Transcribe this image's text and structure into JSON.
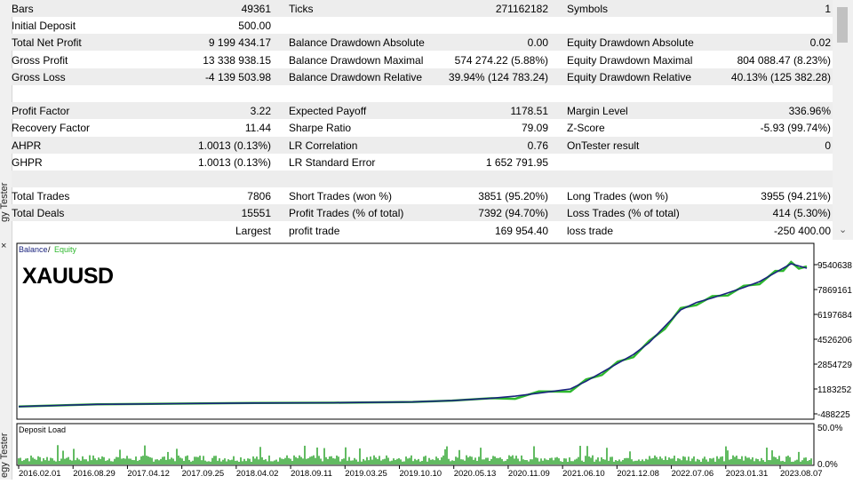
{
  "sidebar": {
    "tab_label_top": "gy Tester",
    "tab_label_bottom": "egy Tester",
    "close_glyph": "×"
  },
  "stats": [
    {
      "gray": true,
      "c1": [
        "Bars",
        "49361"
      ],
      "c2": [
        "Ticks",
        "271162182"
      ],
      "c3": [
        "Symbols",
        "1"
      ]
    },
    {
      "gray": false,
      "c1": [
        "Initial Deposit",
        "500.00"
      ],
      "c2": [
        "",
        ""
      ],
      "c3": [
        "",
        ""
      ]
    },
    {
      "gray": true,
      "c1": [
        "Total Net Profit",
        "9 199 434.17"
      ],
      "c2": [
        "Balance Drawdown Absolute",
        "0.00"
      ],
      "c3": [
        "Equity Drawdown Absolute",
        "0.02"
      ]
    },
    {
      "gray": false,
      "c1": [
        "Gross Profit",
        "13 338 938.15"
      ],
      "c2": [
        "Balance Drawdown Maximal",
        "574 274.22 (5.88%)"
      ],
      "c3": [
        "Equity Drawdown Maximal",
        "804 088.47 (8.23%)"
      ]
    },
    {
      "gray": true,
      "c1": [
        "Gross Loss",
        "-4 139 503.98"
      ],
      "c2": [
        "Balance Drawdown Relative",
        "39.94% (124 783.24)"
      ],
      "c3": [
        "Equity Drawdown Relative",
        "40.13% (125 382.28)"
      ]
    },
    {
      "gray": false,
      "c1": [
        "",
        ""
      ],
      "c2": [
        "",
        ""
      ],
      "c3": [
        "",
        ""
      ]
    },
    {
      "gray": true,
      "c1": [
        "Profit Factor",
        "3.22"
      ],
      "c2": [
        "Expected Payoff",
        "1178.51"
      ],
      "c3": [
        "Margin Level",
        "336.96%"
      ]
    },
    {
      "gray": false,
      "c1": [
        "Recovery Factor",
        "11.44"
      ],
      "c2": [
        "Sharpe Ratio",
        "79.09"
      ],
      "c3": [
        "Z-Score",
        "-5.93 (99.74%)"
      ]
    },
    {
      "gray": true,
      "c1": [
        "AHPR",
        "1.0013 (0.13%)"
      ],
      "c2": [
        "LR Correlation",
        "0.76"
      ],
      "c3": [
        "OnTester result",
        "0"
      ]
    },
    {
      "gray": false,
      "c1": [
        "GHPR",
        "1.0013 (0.13%)"
      ],
      "c2": [
        "LR Standard Error",
        "1 652 791.95"
      ],
      "c3": [
        "",
        ""
      ]
    },
    {
      "gray": true,
      "c1": [
        "",
        ""
      ],
      "c2": [
        "",
        ""
      ],
      "c3": [
        "",
        ""
      ]
    },
    {
      "gray": false,
      "c1": [
        "Total Trades",
        "7806"
      ],
      "c2": [
        "Short Trades (won %)",
        "3851 (95.20%)"
      ],
      "c3": [
        "Long Trades (won %)",
        "3955 (94.21%)"
      ]
    },
    {
      "gray": true,
      "c1": [
        "Total Deals",
        "15551"
      ],
      "c2": [
        "Profit Trades (% of total)",
        "7392 (94.70%)"
      ],
      "c3": [
        "Loss Trades (% of total)",
        "414 (5.30%)"
      ]
    },
    {
      "gray": false,
      "c1": [
        "",
        "Largest"
      ],
      "c2": [
        "profit trade",
        "169 954.40"
      ],
      "c3": [
        "loss trade",
        "-250 400.00"
      ]
    }
  ],
  "chart_data": [
    {
      "type": "line",
      "legend": {
        "balance": "Balance",
        "separator": "/",
        "equity": "Equity"
      },
      "symbol": "XAUUSD",
      "colors": {
        "balance": "#1a237e",
        "equity": "#2eb82e"
      },
      "x_ticks": [
        "2016.02.01",
        "2016.08.29",
        "2017.04.12",
        "2017.09.25",
        "2018.04.02",
        "2018.09.11",
        "2019.03.25",
        "2019.10.10",
        "2020.05.13",
        "2020.11.09",
        "2021.06.10",
        "2021.12.08",
        "2022.07.06",
        "2023.01.31",
        "2023.08.07"
      ],
      "y_ticks": [
        "9540638",
        "7869161",
        "6197684",
        "4526206",
        "2854729",
        "1183252",
        "-488225"
      ],
      "ylim": [
        -488225,
        9540638
      ],
      "series": [
        {
          "name": "Balance",
          "x": [
            0,
            0.05,
            0.1,
            0.2,
            0.3,
            0.4,
            0.5,
            0.55,
            0.6,
            0.63,
            0.66,
            0.7,
            0.72,
            0.74,
            0.76,
            0.78,
            0.8,
            0.82,
            0.84,
            0.86,
            0.88,
            0.9,
            0.92,
            0.94,
            0.96,
            0.97,
            0.98,
            0.99,
            1.0
          ],
          "y": [
            500,
            80000,
            150000,
            200000,
            240000,
            260000,
            310000,
            400000,
            560000,
            700000,
            900000,
            1183000,
            1700000,
            2300000,
            2900000,
            3500000,
            4300000,
            5400000,
            6500000,
            7000000,
            7300000,
            7650000,
            8000000,
            8400000,
            9000000,
            9300000,
            9600000,
            9450000,
            9300000
          ]
        }
      ]
    },
    {
      "type": "bar",
      "title": "Deposit Load",
      "y_ticks": [
        "50.0%",
        "0.0%"
      ],
      "ylim": [
        0,
        50
      ],
      "note": "Deposit load bars span the full period, mostly around 3–10% with occasional spikes near 20%."
    }
  ]
}
